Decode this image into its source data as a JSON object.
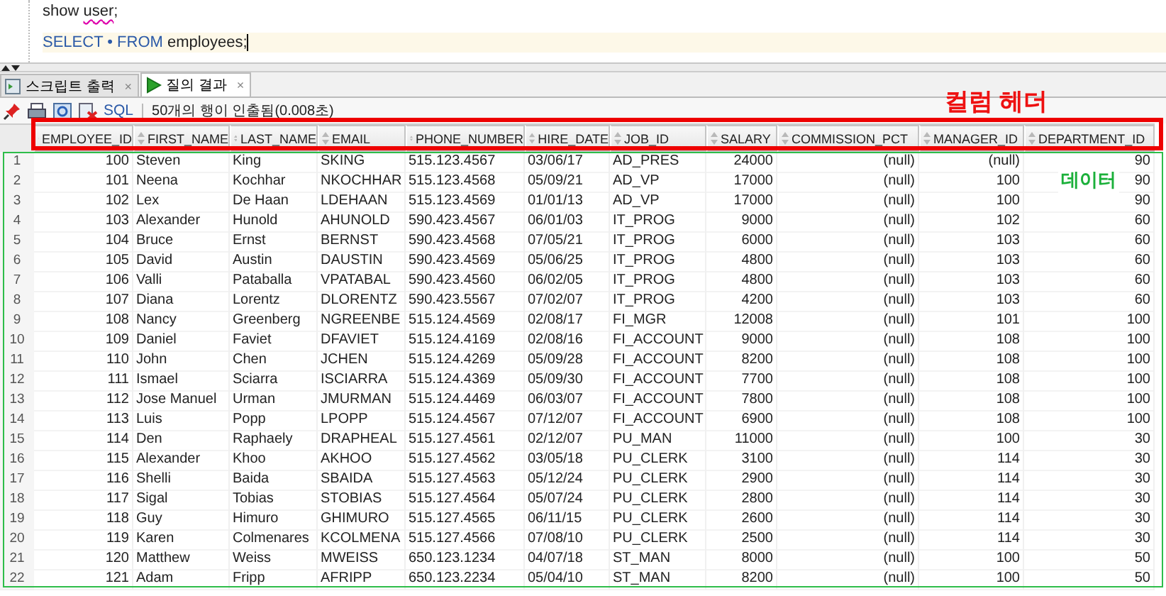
{
  "editor": {
    "lines": [
      {
        "current": false,
        "tokens": [
          {
            "kind": "plain",
            "text": "show "
          },
          {
            "kind": "misspelled",
            "text": "user"
          },
          {
            "kind": "plain",
            "text": ";"
          }
        ]
      },
      {
        "current": true,
        "tokens": [
          {
            "kind": "keyword",
            "text": "SELECT • FROM"
          },
          {
            "kind": "plain",
            "text": " employees;"
          }
        ]
      }
    ]
  },
  "tabs": [
    {
      "label": "스크립트 출력",
      "close": "×",
      "kind": "script",
      "selected": false
    },
    {
      "label": "질의 결과",
      "close": "×",
      "kind": "query",
      "selected": true
    }
  ],
  "toolbar": {
    "sql": "SQL",
    "status": "50개의 행이 인출됨(0.008초)"
  },
  "annotations": [
    {
      "kind": "header",
      "text": "컬럼 헤더"
    },
    {
      "kind": "data",
      "text": "데이터"
    }
  ],
  "table": {
    "columns": [
      {
        "label": "EMPLOYEE_ID",
        "kind": "number"
      },
      {
        "label": "FIRST_NAME",
        "kind": "text"
      },
      {
        "label": "LAST_NAME",
        "kind": "text"
      },
      {
        "label": "EMAIL",
        "kind": "text"
      },
      {
        "label": "PHONE_NUMBER",
        "kind": "text"
      },
      {
        "label": "HIRE_DATE",
        "kind": "text"
      },
      {
        "label": "JOB_ID",
        "kind": "text"
      },
      {
        "label": "SALARY",
        "kind": "number"
      },
      {
        "label": "COMMISSION_PCT",
        "kind": "number"
      },
      {
        "label": "MANAGER_ID",
        "kind": "number"
      },
      {
        "label": "DEPARTMENT_ID",
        "kind": "number"
      }
    ],
    "rows": [
      {
        "num": "1",
        "cells": [
          "100",
          "Steven",
          "King",
          "SKING",
          "515.123.4567",
          "03/06/17",
          "AD_PRES",
          "24000",
          "(null)",
          "(null)",
          "90"
        ]
      },
      {
        "num": "2",
        "cells": [
          "101",
          "Neena",
          "Kochhar",
          "NKOCHHAR",
          "515.123.4568",
          "05/09/21",
          "AD_VP",
          "17000",
          "(null)",
          "100",
          "90"
        ]
      },
      {
        "num": "3",
        "cells": [
          "102",
          "Lex",
          "De Haan",
          "LDEHAAN",
          "515.123.4569",
          "01/01/13",
          "AD_VP",
          "17000",
          "(null)",
          "100",
          "90"
        ]
      },
      {
        "num": "4",
        "cells": [
          "103",
          "Alexander",
          "Hunold",
          "AHUNOLD",
          "590.423.4567",
          "06/01/03",
          "IT_PROG",
          "9000",
          "(null)",
          "102",
          "60"
        ]
      },
      {
        "num": "5",
        "cells": [
          "104",
          "Bruce",
          "Ernst",
          "BERNST",
          "590.423.4568",
          "07/05/21",
          "IT_PROG",
          "6000",
          "(null)",
          "103",
          "60"
        ]
      },
      {
        "num": "6",
        "cells": [
          "105",
          "David",
          "Austin",
          "DAUSTIN",
          "590.423.4569",
          "05/06/25",
          "IT_PROG",
          "4800",
          "(null)",
          "103",
          "60"
        ]
      },
      {
        "num": "7",
        "cells": [
          "106",
          "Valli",
          "Pataballa",
          "VPATABAL",
          "590.423.4560",
          "06/02/05",
          "IT_PROG",
          "4800",
          "(null)",
          "103",
          "60"
        ]
      },
      {
        "num": "8",
        "cells": [
          "107",
          "Diana",
          "Lorentz",
          "DLORENTZ",
          "590.423.5567",
          "07/02/07",
          "IT_PROG",
          "4200",
          "(null)",
          "103",
          "60"
        ]
      },
      {
        "num": "9",
        "cells": [
          "108",
          "Nancy",
          "Greenberg",
          "NGREENBE",
          "515.124.4569",
          "02/08/17",
          "FI_MGR",
          "12008",
          "(null)",
          "101",
          "100"
        ]
      },
      {
        "num": "10",
        "cells": [
          "109",
          "Daniel",
          "Faviet",
          "DFAVIET",
          "515.124.4169",
          "02/08/16",
          "FI_ACCOUNT",
          "9000",
          "(null)",
          "108",
          "100"
        ]
      },
      {
        "num": "11",
        "cells": [
          "110",
          "John",
          "Chen",
          "JCHEN",
          "515.124.4269",
          "05/09/28",
          "FI_ACCOUNT",
          "8200",
          "(null)",
          "108",
          "100"
        ]
      },
      {
        "num": "12",
        "cells": [
          "111",
          "Ismael",
          "Sciarra",
          "ISCIARRA",
          "515.124.4369",
          "05/09/30",
          "FI_ACCOUNT",
          "7700",
          "(null)",
          "108",
          "100"
        ]
      },
      {
        "num": "13",
        "cells": [
          "112",
          "Jose Manuel",
          "Urman",
          "JMURMAN",
          "515.124.4469",
          "06/03/07",
          "FI_ACCOUNT",
          "7800",
          "(null)",
          "108",
          "100"
        ]
      },
      {
        "num": "14",
        "cells": [
          "113",
          "Luis",
          "Popp",
          "LPOPP",
          "515.124.4567",
          "07/12/07",
          "FI_ACCOUNT",
          "6900",
          "(null)",
          "108",
          "100"
        ]
      },
      {
        "num": "15",
        "cells": [
          "114",
          "Den",
          "Raphaely",
          "DRAPHEAL",
          "515.127.4561",
          "02/12/07",
          "PU_MAN",
          "11000",
          "(null)",
          "100",
          "30"
        ]
      },
      {
        "num": "16",
        "cells": [
          "115",
          "Alexander",
          "Khoo",
          "AKHOO",
          "515.127.4562",
          "03/05/18",
          "PU_CLERK",
          "3100",
          "(null)",
          "114",
          "30"
        ]
      },
      {
        "num": "17",
        "cells": [
          "116",
          "Shelli",
          "Baida",
          "SBAIDA",
          "515.127.4563",
          "05/12/24",
          "PU_CLERK",
          "2900",
          "(null)",
          "114",
          "30"
        ]
      },
      {
        "num": "18",
        "cells": [
          "117",
          "Sigal",
          "Tobias",
          "STOBIAS",
          "515.127.4564",
          "05/07/24",
          "PU_CLERK",
          "2800",
          "(null)",
          "114",
          "30"
        ]
      },
      {
        "num": "19",
        "cells": [
          "118",
          "Guy",
          "Himuro",
          "GHIMURO",
          "515.127.4565",
          "06/11/15",
          "PU_CLERK",
          "2600",
          "(null)",
          "114",
          "30"
        ]
      },
      {
        "num": "20",
        "cells": [
          "119",
          "Karen",
          "Colmenares",
          "KCOLMENA",
          "515.127.4566",
          "07/08/10",
          "PU_CLERK",
          "2500",
          "(null)",
          "114",
          "30"
        ]
      },
      {
        "num": "21",
        "cells": [
          "120",
          "Matthew",
          "Weiss",
          "MWEISS",
          "650.123.1234",
          "04/07/18",
          "ST_MAN",
          "8000",
          "(null)",
          "100",
          "50"
        ]
      },
      {
        "num": "22",
        "cells": [
          "121",
          "Adam",
          "Fripp",
          "AFRIPP",
          "650.123.2234",
          "05/04/10",
          "ST_MAN",
          "8200",
          "(null)",
          "100",
          "50"
        ]
      }
    ]
  }
}
